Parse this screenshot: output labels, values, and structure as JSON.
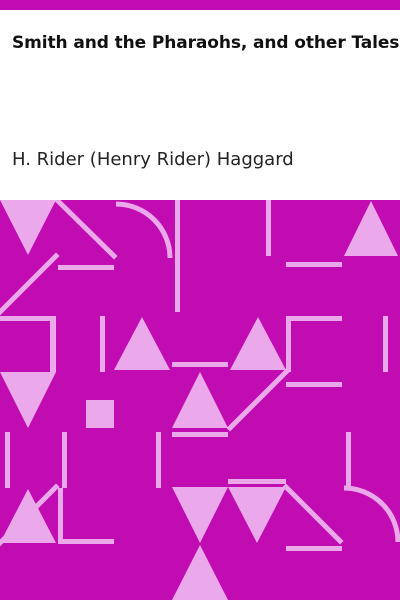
{
  "cover": {
    "title": "Smith and the Pharaohs, and other Tales",
    "author": "H. Rider (Henry Rider) Haggard",
    "accent_color": "#c00cb0",
    "pattern_color": "#eba8ea"
  }
}
